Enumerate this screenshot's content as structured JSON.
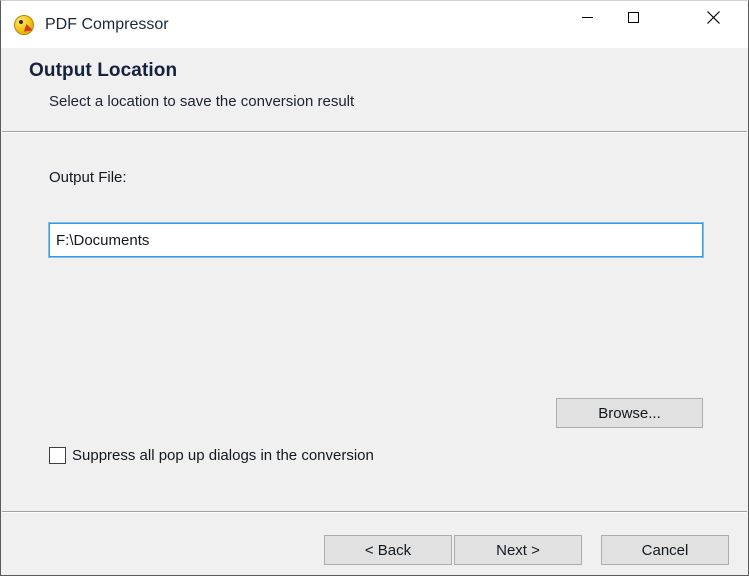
{
  "window": {
    "title": "PDF Compressor",
    "app_icon": "app-logo-icon",
    "controls": {
      "minimize": "minimize-icon",
      "maximize": "maximize-icon",
      "close": "close-icon"
    }
  },
  "header": {
    "title": "Output Location",
    "subtitle": "Select a location to save the conversion result"
  },
  "body": {
    "output_file_label": "Output File:",
    "output_file_value": "F:\\Documents",
    "output_file_placeholder": "",
    "browse_label": "Browse...",
    "suppress_label": "Suppress all pop up dialogs in the conversion",
    "suppress_checked": false
  },
  "footer": {
    "back_label": "< Back",
    "next_label": "Next >",
    "cancel_label": "Cancel"
  },
  "colors": {
    "window_background": "#f0f0f0",
    "titlebar_background": "#ffffff",
    "header_title": "#16213e",
    "input_focus_border": "#3399e5",
    "button_face": "#e1e1e1",
    "button_border": "#adadad",
    "separator": "#a0a0a0"
  }
}
